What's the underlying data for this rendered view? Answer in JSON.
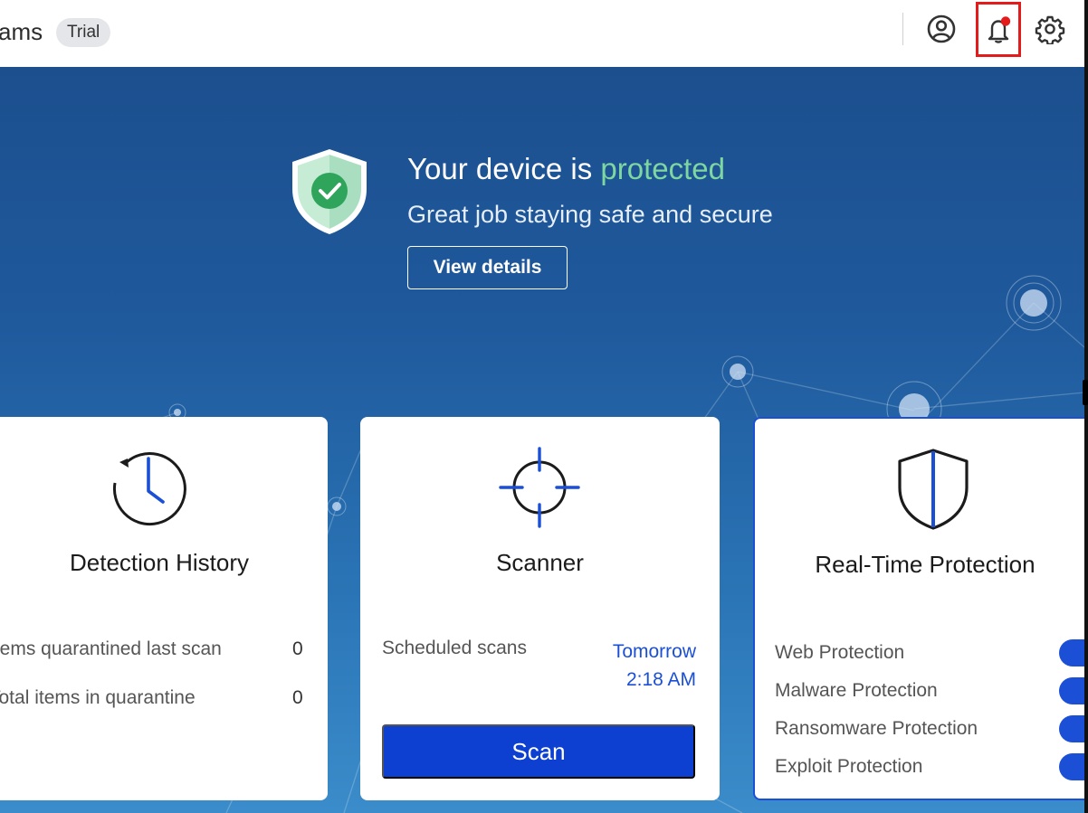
{
  "header": {
    "app_name": "ams",
    "badge": "Trial",
    "icons": [
      "account-icon",
      "notification-bell-icon",
      "settings-gear-icon"
    ],
    "notification_dot_color": "#e31b1b",
    "highlight_color": "#e31b1b"
  },
  "status": {
    "title_prefix": "Your device is ",
    "title_status": "protected",
    "subtitle": "Great job staying safe and secure",
    "view_details_label": "View details",
    "status_color": "#7ed6a0"
  },
  "detection_history": {
    "title": "Detection History",
    "rows": [
      {
        "label": "Items quarantined last scan",
        "value": "0"
      },
      {
        "label": "Total items in quarantine",
        "value": "0"
      }
    ]
  },
  "scanner": {
    "title": "Scanner",
    "scheduled_label": "Scheduled scans",
    "scheduled_day": "Tomorrow",
    "scheduled_time": "2:18 AM",
    "scan_label": "Scan"
  },
  "realtime": {
    "title": "Real-Time Protection",
    "items": [
      {
        "label": "Web Protection",
        "enabled": true
      },
      {
        "label": "Malware Protection",
        "enabled": true
      },
      {
        "label": "Ransomware Protection",
        "enabled": true
      },
      {
        "label": "Exploit Protection",
        "enabled": true
      }
    ]
  },
  "colors": {
    "accent": "#1a4fd6",
    "hero_bg": "#1f5a9d"
  }
}
